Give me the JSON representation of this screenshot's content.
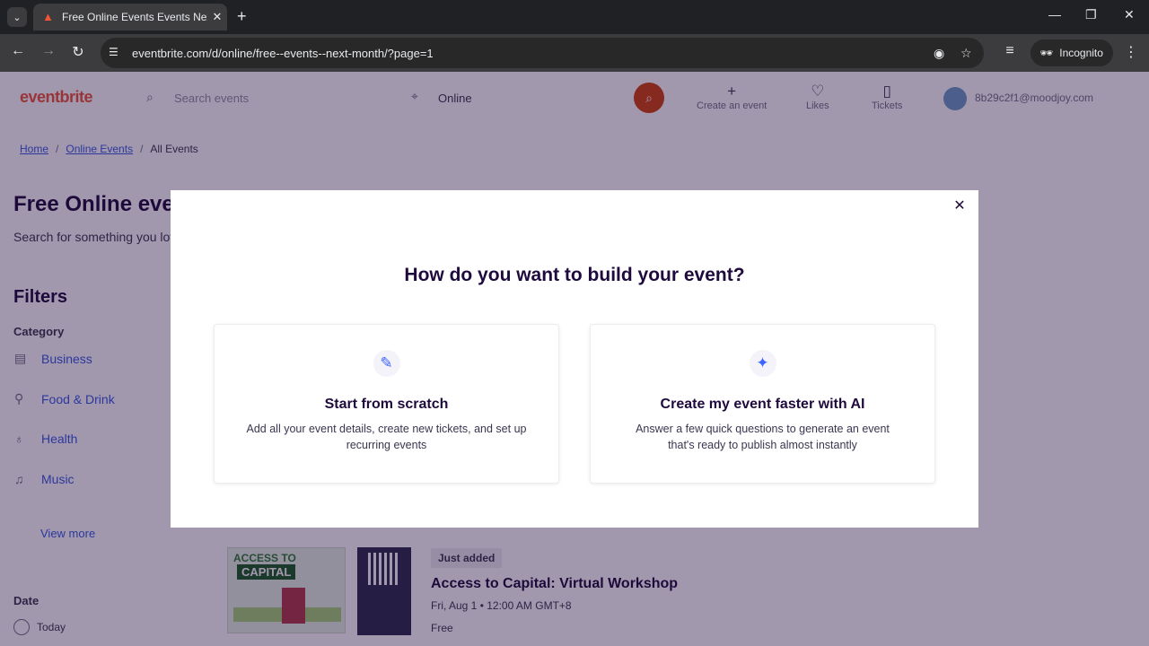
{
  "browser": {
    "tab_title": "Free Online Events Events Next",
    "url": "eventbrite.com/d/online/free--events--next-month/?page=1",
    "incognito_label": "Incognito"
  },
  "header": {
    "logo": "eventbrite",
    "search_placeholder": "Search events",
    "location": "Online",
    "create_event": "Create an event",
    "likes": "Likes",
    "tickets": "Tickets",
    "email": "8b29c2f1@moodjoy.com"
  },
  "breadcrumb": {
    "home": "Home",
    "online_events": "Online Events",
    "current": "All Events"
  },
  "page": {
    "title": "Free Online events",
    "subtitle": "Search for something you love"
  },
  "filters": {
    "heading": "Filters",
    "category_heading": "Category",
    "categories": [
      "Business",
      "Food & Drink",
      "Health",
      "Music"
    ],
    "view_more": "View more",
    "date_heading": "Date",
    "date_today": "Today"
  },
  "event": {
    "image_text_1": "ACCESS TO",
    "image_text_2": "CAPITAL",
    "badge": "Just added",
    "title": "Access to Capital: Virtual Workshop",
    "date": "Fri, Aug 1 • 12:00 AM GMT+8",
    "price": "Free"
  },
  "modal": {
    "heading": "How do you want to build your event?",
    "options": [
      {
        "title": "Start from scratch",
        "description": "Add all your event details, create new tickets, and set up recurring events",
        "icon": "pencil-icon"
      },
      {
        "title": "Create my event faster with AI",
        "description": "Answer a few quick questions to generate an event that's ready to publish almost instantly",
        "icon": "magic-wand-icon"
      }
    ]
  },
  "colors": {
    "brand": "#f05537",
    "accent": "#3d64ff",
    "search_button": "#d1410c"
  }
}
